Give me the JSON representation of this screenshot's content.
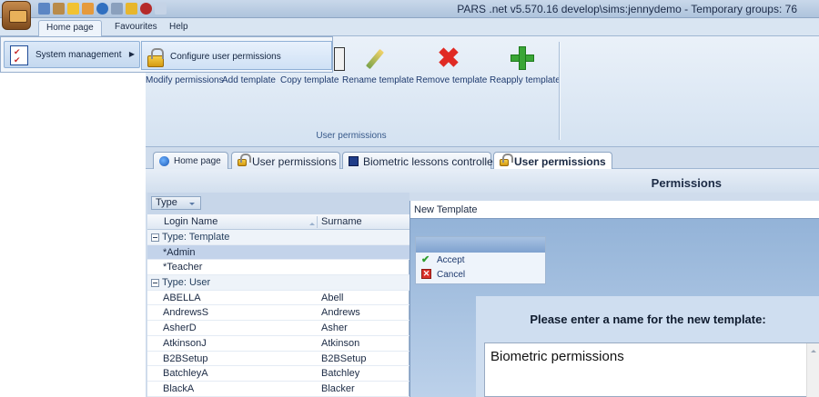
{
  "window": {
    "title": "PARS .net v5.570.16  develop\\sims:jennydemo - Temporary groups: 76"
  },
  "ribbon_tabs": [
    "Home page",
    "Favourites",
    "Help"
  ],
  "app_menu": {
    "items": [
      {
        "label": "System management",
        "icon": "checklist-icon"
      }
    ],
    "submenu": [
      {
        "label": "Configure user permissions",
        "icon": "lock-icon"
      }
    ]
  },
  "ribbon": {
    "group_label": "User permissions",
    "buttons": [
      {
        "label": "Modify permissions",
        "icon": "checkmark-icon"
      },
      {
        "label": "Add template",
        "icon": "plus-icon"
      },
      {
        "label": "Copy template",
        "icon": "pencil-icon"
      },
      {
        "label": "Rename template",
        "icon": "pencil-icon"
      },
      {
        "label": "Remove template",
        "icon": "x-icon"
      },
      {
        "label": "Reapply template",
        "icon": "plus-icon"
      }
    ]
  },
  "document_tabs": [
    {
      "label": "Home page",
      "icon": "home-icon"
    },
    {
      "label": "User permissions",
      "icon": "lock-icon"
    },
    {
      "label": "Biometric lessons controller",
      "icon": "monitor-icon"
    },
    {
      "label": "User permissions",
      "icon": "lock-icon",
      "active": true
    }
  ],
  "panel": {
    "title": "Permissions"
  },
  "grid": {
    "group_by_chip": "Type",
    "columns": [
      "Login Name",
      "Surname"
    ],
    "groups": [
      {
        "label": "Type: Template",
        "rows": [
          {
            "login": "*Admin",
            "surname": "",
            "selected": true
          },
          {
            "login": "*Teacher",
            "surname": ""
          }
        ]
      },
      {
        "label": "Type: User",
        "rows": [
          {
            "login": "ABELLA",
            "surname": "Abell"
          },
          {
            "login": "AndrewsS",
            "surname": "Andrews"
          },
          {
            "login": "AsherD",
            "surname": "Asher"
          },
          {
            "login": "AtkinsonJ",
            "surname": "Atkinson"
          },
          {
            "login": "B2BSetup",
            "surname": "B2BSetup"
          },
          {
            "login": "BatchleyA",
            "surname": "Batchley"
          },
          {
            "login": "BlackA",
            "surname": "Blacker"
          }
        ]
      }
    ]
  },
  "dialog": {
    "title": "New Template",
    "actions": [
      {
        "label": "Accept",
        "icon": "green-check-icon"
      },
      {
        "label": "Cancel",
        "icon": "red-x-icon"
      }
    ],
    "prompt": "Please enter a name for the new template:",
    "name_value": "Biometric permissions"
  },
  "colors": {
    "accent": "#3aa636",
    "danger": "#e02a24",
    "selected_row": "#c3d3ea"
  }
}
